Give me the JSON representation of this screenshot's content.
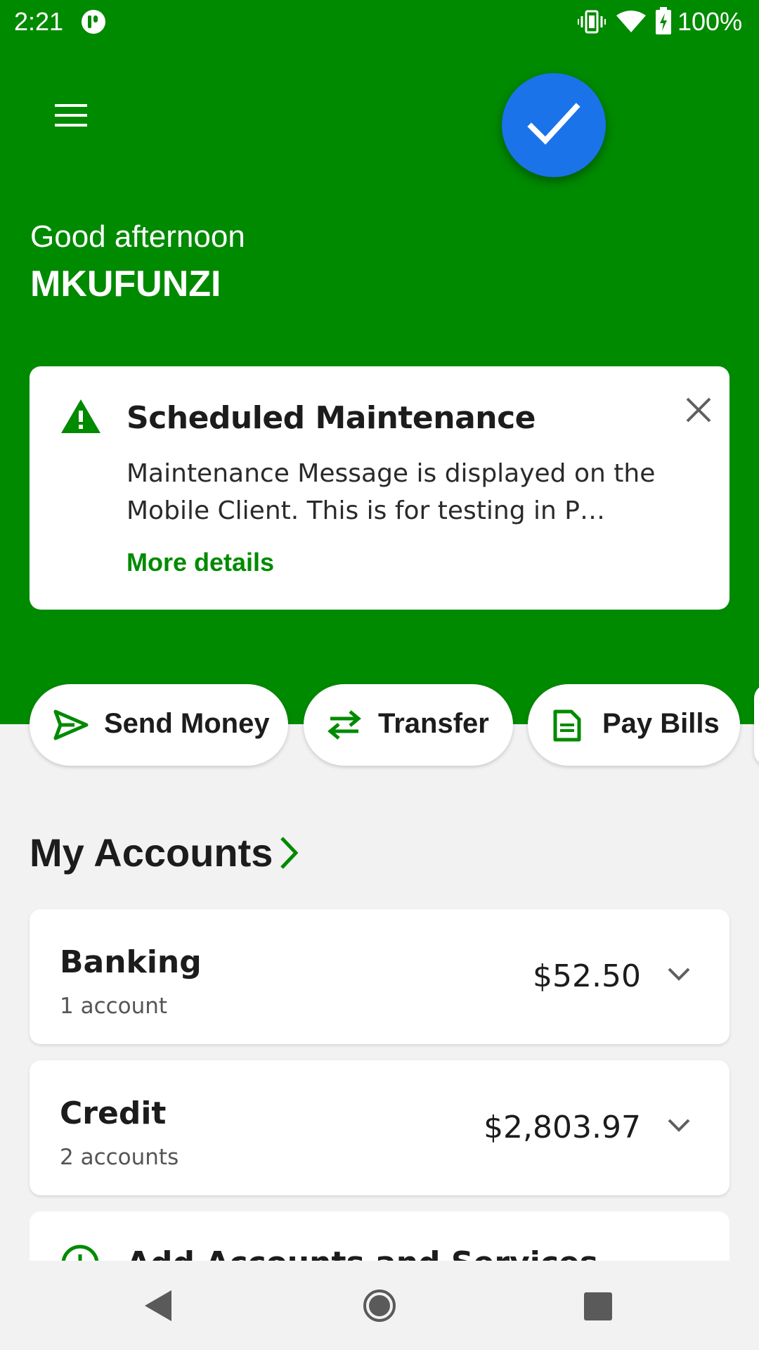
{
  "status_bar": {
    "time": "2:21",
    "battery": "100%",
    "icons": [
      "app-notification-icon",
      "vibrate-icon",
      "wifi-icon",
      "battery-charging-icon"
    ]
  },
  "header": {
    "menu_icon": "hamburger-menu-icon",
    "fab_icon": "checkmark-icon",
    "greeting": "Good afternoon",
    "username": "MKUFUNZI"
  },
  "notice": {
    "icon": "warning-icon",
    "title": "Scheduled Maintenance",
    "body": "Maintenance Message is displayed on the Mobile Client. This is for testing in P…",
    "link": "More details",
    "close_icon": "close-icon"
  },
  "actions": [
    {
      "label": "Send Money",
      "icon": "send-icon"
    },
    {
      "label": "Transfer",
      "icon": "transfer-arrows-icon"
    },
    {
      "label": "Pay Bills",
      "icon": "bill-document-icon"
    }
  ],
  "accounts_section": {
    "title": "My Accounts",
    "chevron_icon": "chevron-right-icon"
  },
  "accounts": [
    {
      "name": "Banking",
      "count": "1 account",
      "balance": "$52.50"
    },
    {
      "name": "Credit",
      "count": "2 accounts",
      "balance": "$2,803.97"
    }
  ],
  "add_accounts": {
    "label": "Add Accounts and Services",
    "icon": "add-circle-icon"
  },
  "nav_bar": {
    "icons": [
      "back-icon",
      "home-icon",
      "recents-icon"
    ]
  },
  "colors": {
    "brand_green": "#008a00",
    "fab_blue": "#1a73e8",
    "background": "#f2f2f2",
    "card": "#ffffff"
  }
}
